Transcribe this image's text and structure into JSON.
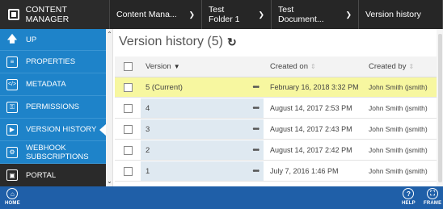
{
  "app": {
    "brand": "CONTENT MANAGER"
  },
  "breadcrumbs": [
    {
      "label": "Content Mana..."
    },
    {
      "label": "Test Folder 1"
    },
    {
      "label": "Test Document..."
    },
    {
      "label": "Version history"
    }
  ],
  "sidebar": {
    "items": [
      {
        "label": "UP",
        "icon": "arrow-up-icon"
      },
      {
        "label": "PROPERTIES",
        "icon": "list-icon"
      },
      {
        "label": "METADATA",
        "icon": "code-icon"
      },
      {
        "label": "PERMISSIONS",
        "icon": "key-icon"
      },
      {
        "label": "VERSION HISTORY",
        "icon": "history-icon"
      },
      {
        "label": "WEBHOOK SUBSCRIPTIONS",
        "icon": "webhook-icon"
      },
      {
        "label": "PORTAL",
        "icon": "portal-icon"
      }
    ],
    "active_index": 4
  },
  "main": {
    "title": "Version history (5)",
    "refresh_icon": "refresh-icon"
  },
  "table": {
    "columns": {
      "version": "Version",
      "created_on": "Created on",
      "created_by": "Created by"
    },
    "rows": [
      {
        "version": "5 (Current)",
        "created_on": "February 16, 2018 3:32 PM",
        "created_by": "John Smith (jsmith)"
      },
      {
        "version": "4",
        "created_on": "August 14, 2017 2:53 PM",
        "created_by": "John Smith (jsmith)"
      },
      {
        "version": "3",
        "created_on": "August 14, 2017 2:43 PM",
        "created_by": "John Smith (jsmith)"
      },
      {
        "version": "2",
        "created_on": "August 14, 2017 2:42 PM",
        "created_by": "John Smith (jsmith)"
      },
      {
        "version": "1",
        "created_on": "July 7, 2016 1:46 PM",
        "created_by": "John Smith (jsmith)"
      }
    ]
  },
  "bottombar": {
    "home": "HOME",
    "help": "HELP",
    "frame": "FRAME"
  },
  "colors": {
    "sidebar": "#1e83c9",
    "topbar": "#262626",
    "bottombar": "#1f5fa8",
    "highlight": "#f7f7a0"
  }
}
